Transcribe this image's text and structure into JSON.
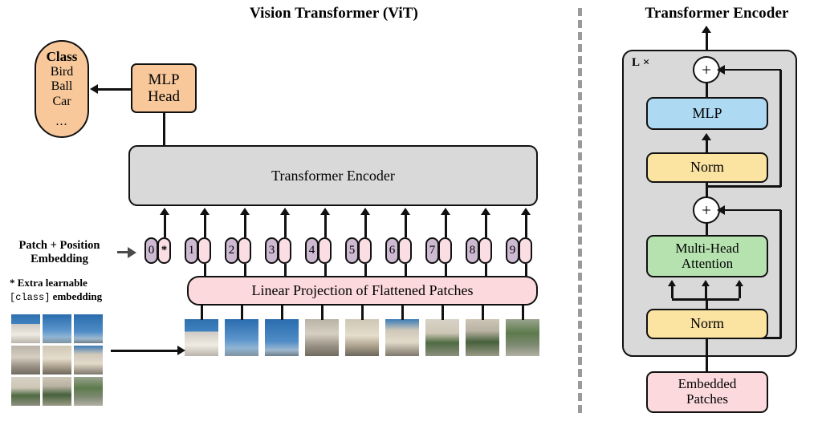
{
  "left_panel": {
    "title": "Vision Transformer (ViT)",
    "class_box": {
      "heading": "Class",
      "items": [
        "Bird",
        "Ball",
        "Car"
      ],
      "ellipsis": "..."
    },
    "mlp_head": {
      "line1": "MLP",
      "line2": "Head"
    },
    "transformer_encoder_label": "Transformer Encoder",
    "embedding_label": {
      "line1": "Patch + Position",
      "line2": "Embedding"
    },
    "footnote": {
      "marker": "*",
      "line1": "Extra learnable",
      "mono": "[class]",
      "line2_tail": " embedding"
    },
    "linear_projection_label": "Linear Projection of Flattened Patches",
    "tokens": [
      {
        "position": "0",
        "patch": "*"
      },
      {
        "position": "1",
        "patch": ""
      },
      {
        "position": "2",
        "patch": ""
      },
      {
        "position": "3",
        "patch": ""
      },
      {
        "position": "4",
        "patch": ""
      },
      {
        "position": "5",
        "patch": ""
      },
      {
        "position": "6",
        "patch": ""
      },
      {
        "position": "7",
        "patch": ""
      },
      {
        "position": "8",
        "patch": ""
      },
      {
        "position": "9",
        "patch": ""
      }
    ],
    "source_image_grid": {
      "rows": 3,
      "cols": 3,
      "description": "photograph of a building split into 3x3 patches"
    },
    "patch_sequence_count": 9
  },
  "right_panel": {
    "title": "Transformer Encoder",
    "repeat_label": "L ×",
    "blocks": {
      "mlp": "MLP",
      "norm_top": "Norm",
      "multi_head_attention": {
        "line1": "Multi-Head",
        "line2": "Attention"
      },
      "norm_bottom": "Norm",
      "embedded_patches": {
        "line1": "Embedded",
        "line2": "Patches"
      }
    },
    "residual_add_symbol": "+",
    "attention_input_arrows": 3
  },
  "colors": {
    "orange": "#f8c89b",
    "pink": "#fbd9dc",
    "token_position": "#cdb9d1",
    "token_patch": "#fadee3",
    "gray_panel": "#d9d9d9",
    "blue_mlp": "#aed9f2",
    "yellow_norm": "#fbe3a2",
    "green_attention": "#b6e2b0",
    "stroke": "#111111",
    "divider": "#9a9a9a"
  }
}
